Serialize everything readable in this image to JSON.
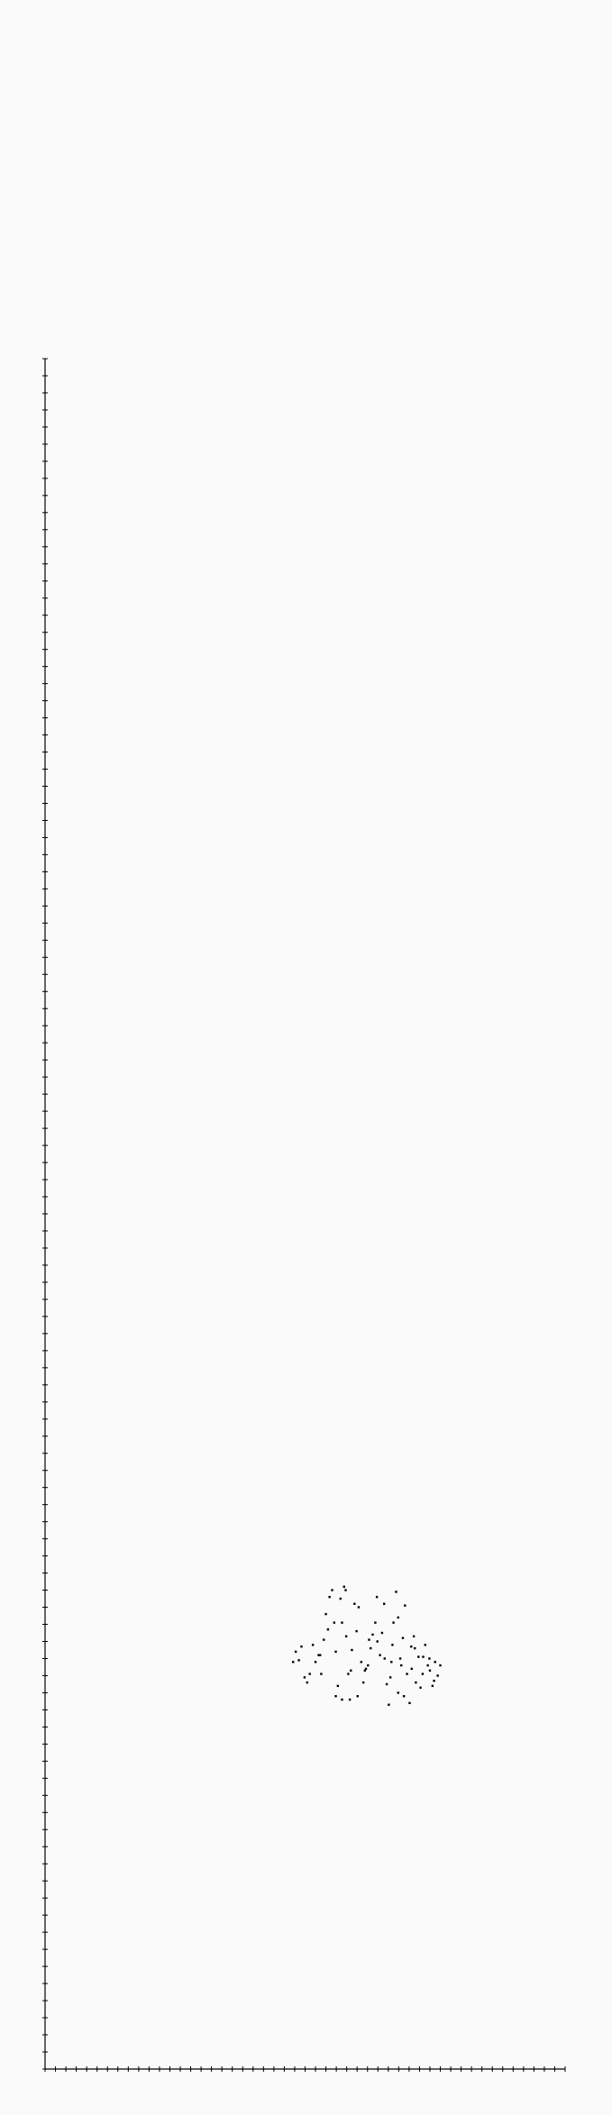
{
  "chart_data": {
    "type": "scatter",
    "title": "",
    "xlabel": "",
    "ylabel": "",
    "grid": false,
    "legend": "none",
    "xlim": [
      0,
      100
    ],
    "ylim": [
      0,
      100
    ],
    "xtick_step": 2,
    "ytick_step": 1,
    "marker_color": "#000000",
    "axis_color": "#000000",
    "background": "#fafafa",
    "series": [
      {
        "points": [
          [
            47.7,
            23.8
          ],
          [
            48.2,
            24.4
          ],
          [
            48.8,
            23.9
          ],
          [
            49.3,
            24.7
          ],
          [
            49.9,
            22.9
          ],
          [
            50.4,
            22.6
          ],
          [
            50.9,
            23.1
          ],
          [
            51.5,
            24.8
          ],
          [
            52.0,
            23.8
          ],
          [
            52.6,
            24.2
          ],
          [
            53.1,
            23.1
          ],
          [
            53.6,
            25.1
          ],
          [
            54.0,
            26.6
          ],
          [
            54.4,
            25.7
          ],
          [
            54.7,
            27.6
          ],
          [
            55.2,
            28.0
          ],
          [
            55.6,
            26.1
          ],
          [
            55.9,
            24.4
          ],
          [
            56.3,
            22.4
          ],
          [
            56.8,
            27.5
          ],
          [
            57.1,
            26.1
          ],
          [
            57.5,
            28.2
          ],
          [
            57.9,
            25.3
          ],
          [
            58.3,
            23.1
          ],
          [
            58.6,
            21.6
          ],
          [
            59.0,
            24.5
          ],
          [
            59.5,
            27.2
          ],
          [
            59.9,
            25.6
          ],
          [
            60.3,
            27.0
          ],
          [
            60.8,
            23.8
          ],
          [
            61.2,
            22.6
          ],
          [
            61.7,
            23.4
          ],
          [
            62.1,
            23.6
          ],
          [
            62.6,
            24.6
          ],
          [
            63.0,
            25.4
          ],
          [
            63.5,
            26.1
          ],
          [
            63.9,
            25.0
          ],
          [
            64.4,
            24.2
          ],
          [
            64.8,
            25.5
          ],
          [
            65.3,
            24.0
          ],
          [
            65.7,
            22.5
          ],
          [
            66.1,
            21.3
          ],
          [
            66.6,
            23.8
          ],
          [
            67.0,
            26.1
          ],
          [
            67.5,
            27.9
          ],
          [
            67.9,
            22.0
          ],
          [
            68.3,
            24.0
          ],
          [
            68.8,
            25.2
          ],
          [
            69.2,
            27.1
          ],
          [
            69.6,
            23.1
          ],
          [
            70.1,
            21.4
          ],
          [
            70.5,
            23.4
          ],
          [
            70.9,
            25.3
          ],
          [
            71.3,
            22.6
          ],
          [
            71.8,
            24.1
          ],
          [
            72.2,
            22.3
          ],
          [
            72.7,
            24.1
          ],
          [
            73.1,
            24.8
          ],
          [
            73.6,
            23.6
          ],
          [
            74.0,
            23.3
          ],
          [
            74.5,
            22.4
          ],
          [
            75.0,
            23.8
          ],
          [
            75.5,
            23.0
          ],
          [
            76.0,
            23.6
          ],
          [
            55.9,
            21.8
          ],
          [
            57.1,
            21.6
          ],
          [
            57.8,
            28.0
          ],
          [
            60.1,
            21.8
          ],
          [
            63.8,
            27.6
          ],
          [
            65.2,
            27.2
          ],
          [
            66.4,
            22.9
          ],
          [
            67.9,
            26.4
          ],
          [
            69.0,
            21.8
          ],
          [
            70.4,
            24.7
          ],
          [
            72.6,
            23.1
          ],
          [
            74.8,
            22.7
          ],
          [
            52.9,
            24.2
          ],
          [
            58.8,
            23.3
          ],
          [
            61.5,
            23.3
          ],
          [
            62.3,
            25.1
          ],
          [
            66.8,
            24.8
          ],
          [
            68.5,
            23.6
          ],
          [
            71.1,
            24.6
          ],
          [
            73.9,
            24.0
          ]
        ]
      }
    ]
  }
}
